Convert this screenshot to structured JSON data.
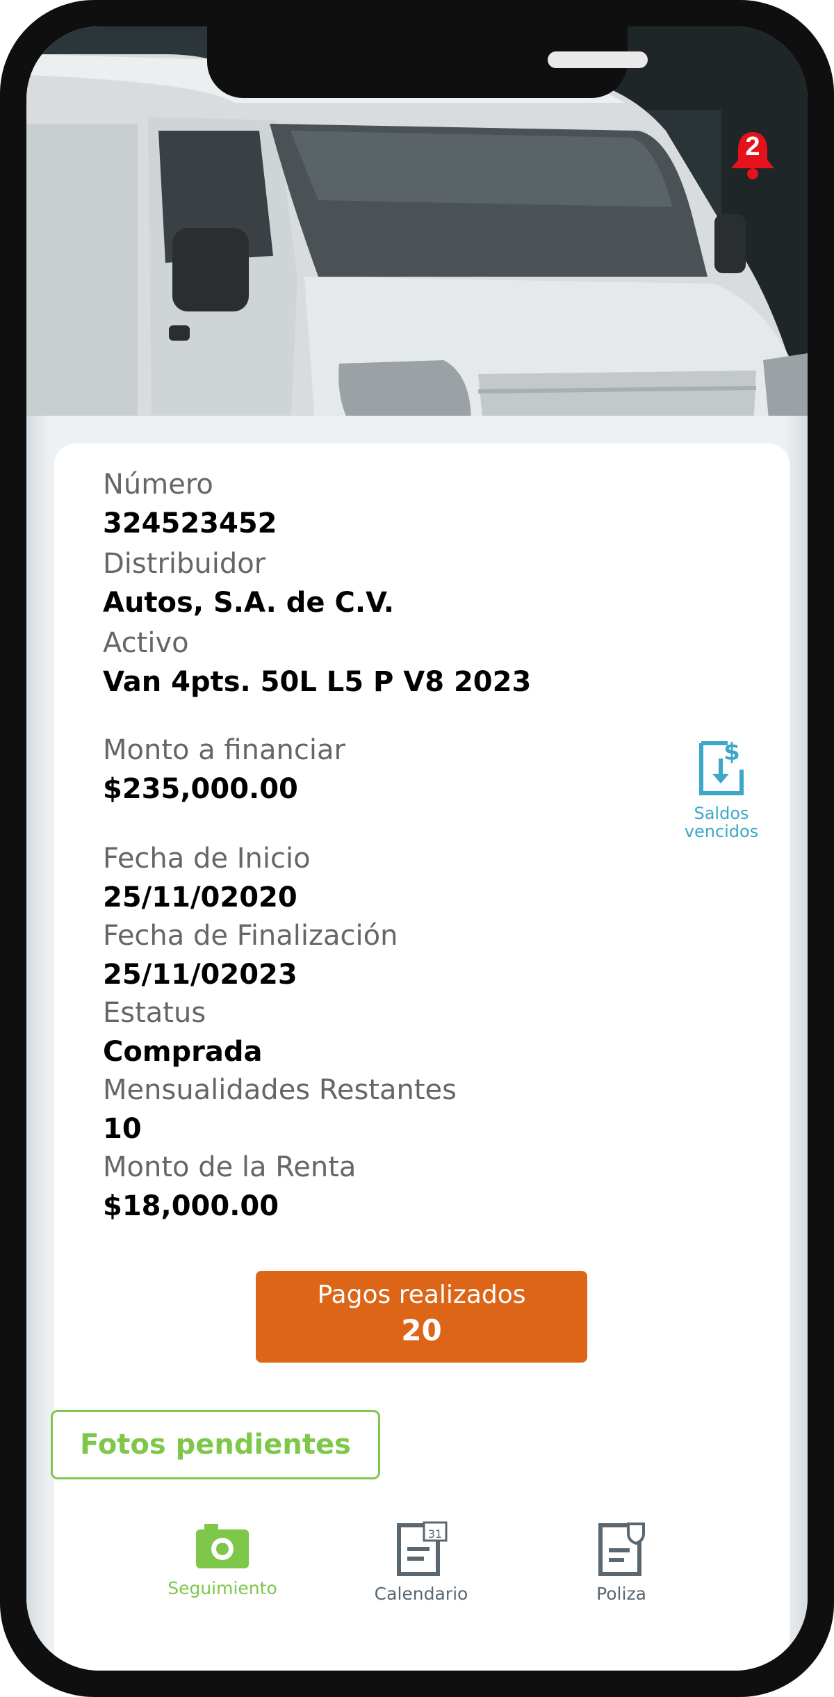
{
  "notification": {
    "count": "2"
  },
  "details": {
    "numero_label": "Número",
    "numero_value": "324523452",
    "distribuidor_label": "Distribuidor",
    "distribuidor_value": "Autos, S.A. de C.V.",
    "activo_label": "Activo",
    "activo_value": "Van 4pts. 50L L5 P V8 2023",
    "monto_financiar_label": "Monto a financiar",
    "monto_financiar_value": "$235,000.00",
    "fecha_inicio_label": "Fecha de Inicio",
    "fecha_inicio_value": "25/11/02020",
    "fecha_fin_label": "Fecha de Finalización",
    "fecha_fin_value": "25/11/02023",
    "estatus_label": "Estatus",
    "estatus_value": "Comprada",
    "mensualidades_label": "Mensualidades Restantes",
    "mensualidades_value": "10",
    "monto_renta_label": "Monto de la Renta",
    "monto_renta_value": "$18,000.00"
  },
  "saldos": {
    "line1": "Saldos",
    "line2": "vencidos",
    "icon": "dollar-download-icon"
  },
  "pagos": {
    "label": "Pagos realizados",
    "value": "20"
  },
  "tooltip": {
    "text": "Fotos pendientes"
  },
  "nav": {
    "items": [
      {
        "label": "Seguimiento",
        "icon": "camera-icon",
        "active": true
      },
      {
        "label": "Calendario",
        "icon": "calendar-doc-icon",
        "active": false
      },
      {
        "label": "Poliza",
        "icon": "policy-doc-icon",
        "active": false
      }
    ]
  },
  "colors": {
    "accent_orange": "#dc6518",
    "accent_green": "#7ec74b",
    "accent_blue": "#3ba7c9",
    "notification_red": "#e5111c",
    "nav_gray": "#5a6770"
  }
}
